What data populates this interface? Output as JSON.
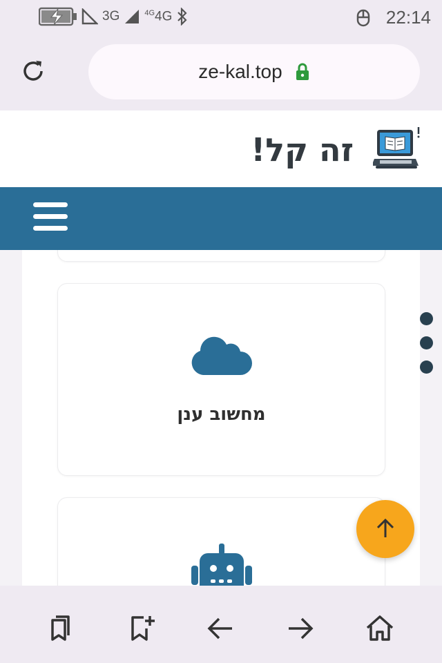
{
  "status_bar": {
    "network_3g": "3G",
    "network_4g_small": "4G",
    "network_4g": "4G",
    "time": "22:14",
    "icons": [
      "battery-charging-icon",
      "signal-icon",
      "bluetooth-icon",
      "notification-icon"
    ]
  },
  "browser": {
    "url": "ze-kal.top",
    "icons": [
      "reload-icon",
      "lock-icon"
    ]
  },
  "site": {
    "title": "זה קל!",
    "logo_icon": "laptop-book-icon",
    "brand_color": "#2a6e97"
  },
  "cards": [
    {
      "label": "מחשוב ענן",
      "icon": "cloud-icon"
    },
    {
      "label": "",
      "icon": "robot-icon"
    }
  ],
  "scroll_top": {
    "icon": "arrow-up-icon",
    "color": "#f7a61c"
  },
  "bottom_bar": {
    "buttons": [
      "bookmarks-icon",
      "add-bookmark-icon",
      "back-arrow-icon",
      "forward-arrow-icon",
      "home-icon"
    ]
  }
}
